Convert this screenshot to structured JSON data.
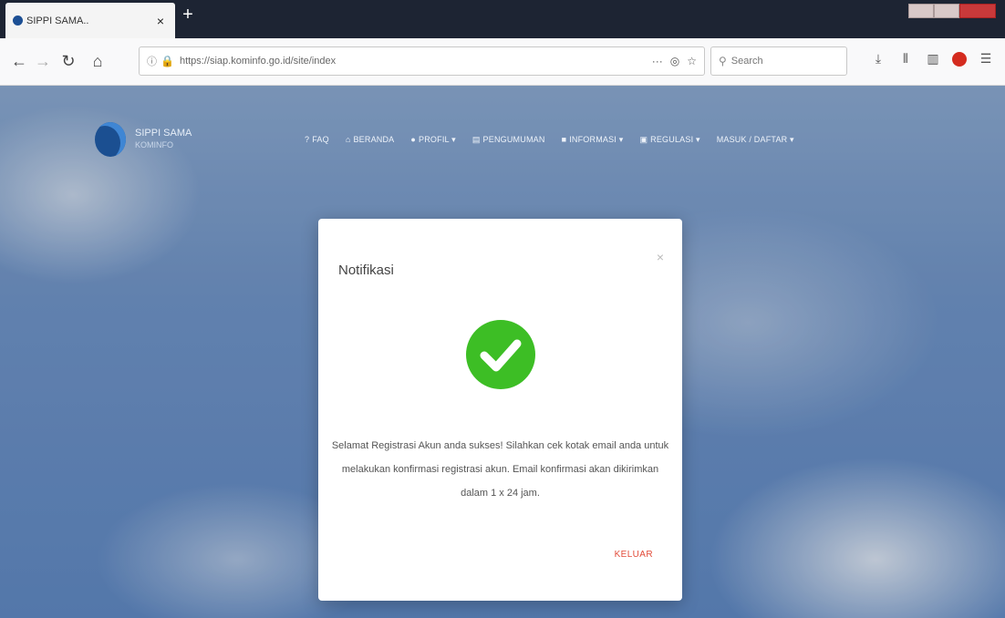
{
  "browser": {
    "tab_title": "SIPPI SAMA..",
    "tab_close": "×",
    "new_tab": "+",
    "url": "https://siap.kominfo.go.id/site/index",
    "url_more": "···",
    "search_placeholder": "Search"
  },
  "header": {
    "brand_name": "SIPPI SAMA",
    "brand_sub": "KOMINFO",
    "menu": [
      {
        "icon": "?",
        "label": "FAQ"
      },
      {
        "icon": "⌂",
        "label": "BERANDA"
      },
      {
        "icon": "●",
        "label": "PROFIL ▾"
      },
      {
        "icon": "▤",
        "label": "PENGUMUMAN"
      },
      {
        "icon": "■",
        "label": "INFORMASI ▾"
      },
      {
        "icon": "▣",
        "label": "REGULASI ▾"
      },
      {
        "icon": "",
        "label": "MASUK / DAFTAR ▾"
      }
    ]
  },
  "modal": {
    "title": "Notifikasi",
    "close": "×",
    "message": "Selamat Registrasi Akun anda sukses! Silahkan cek kotak email anda untuk melakukan konfirmasi registrasi akun. Email konfirmasi akan dikirimkan dalam 1 x 24 jam.",
    "button": "KELUAR"
  },
  "colors": {
    "success_green": "#3dbe25",
    "accent_red": "#e24c3a"
  }
}
